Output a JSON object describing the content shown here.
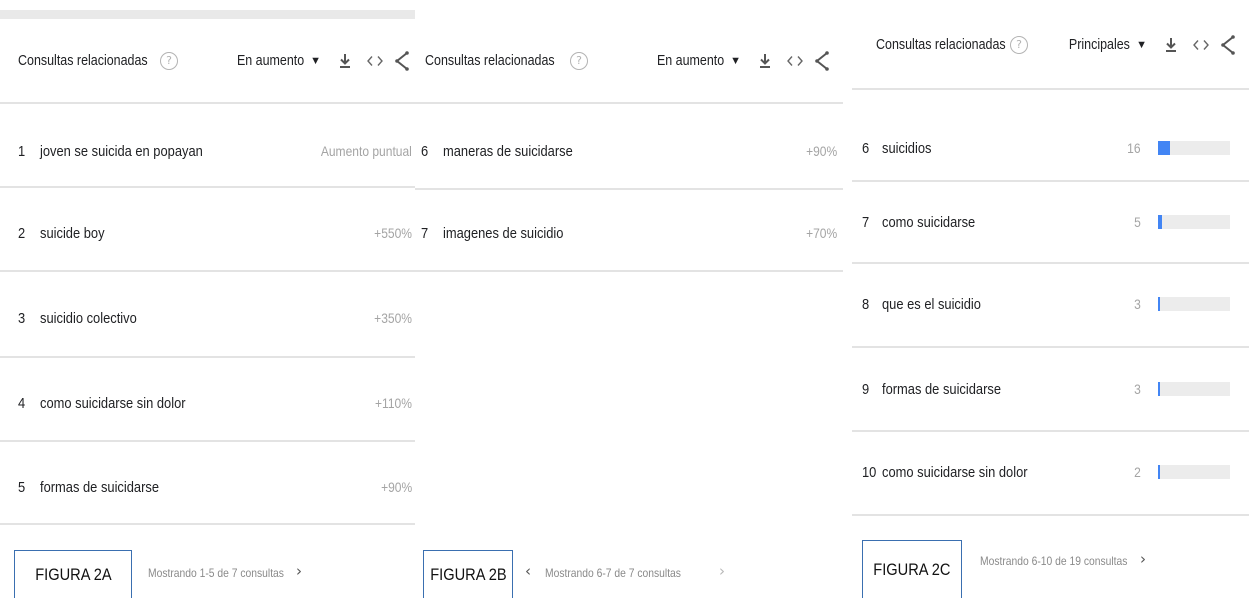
{
  "panels": [
    {
      "header": {
        "title": "Consultas relacionadas",
        "help_icon": "?",
        "select": "En aumento"
      },
      "rows": [
        {
          "rank": "1",
          "query": "joven se suicida en popayan",
          "value": "Aumento puntual"
        },
        {
          "rank": "2",
          "query": "suicide boy",
          "value": "+550%"
        },
        {
          "rank": "3",
          "query": "suicidio colectivo",
          "value": "+350%"
        },
        {
          "rank": "4",
          "query": "como suicidarse sin dolor",
          "value": "+110%"
        },
        {
          "rank": "5",
          "query": "formas de suicidarse",
          "value": "+90%"
        }
      ],
      "footer": {
        "figure": "FIGURA 2A",
        "pagination": "Mostrando 1-5 de 7 consultas",
        "prev": "",
        "next": "›"
      }
    },
    {
      "header": {
        "title": "Consultas relacionadas",
        "help_icon": "?",
        "select": "En aumento"
      },
      "rows": [
        {
          "rank": "6",
          "query": "maneras de suicidarse",
          "value": "+90%"
        },
        {
          "rank": "7",
          "query": "imagenes de suicidio",
          "value": "+70%"
        }
      ],
      "footer": {
        "figure": "FIGURA 2B",
        "pagination": "Mostrando 6-7 de 7 consultas",
        "prev": "‹",
        "next": "›"
      }
    },
    {
      "header": {
        "title": "Consultas relacionadas",
        "help_icon": "?",
        "select": "Principales"
      },
      "rows": [
        {
          "rank": "6",
          "query": "suicidios",
          "value": "16",
          "bar_fraction": 0.16
        },
        {
          "rank": "7",
          "query": "como suicidarse",
          "value": "5",
          "bar_fraction": 0.05
        },
        {
          "rank": "8",
          "query": "que es el suicidio",
          "value": "3",
          "bar_fraction": 0.03
        },
        {
          "rank": "9",
          "query": "formas de suicidarse",
          "value": "3",
          "bar_fraction": 0.03
        },
        {
          "rank": "10",
          "query": "como suicidarse sin dolor",
          "value": "2",
          "bar_fraction": 0.02
        }
      ],
      "footer": {
        "figure": "FIGURA 2C",
        "pagination": "Mostrando 6-10 de 19 consultas",
        "prev": "",
        "next": "›"
      }
    }
  ],
  "colors": {
    "bar": "#4285f4",
    "track": "#ececec",
    "figure_border": "#3a6fb0"
  }
}
